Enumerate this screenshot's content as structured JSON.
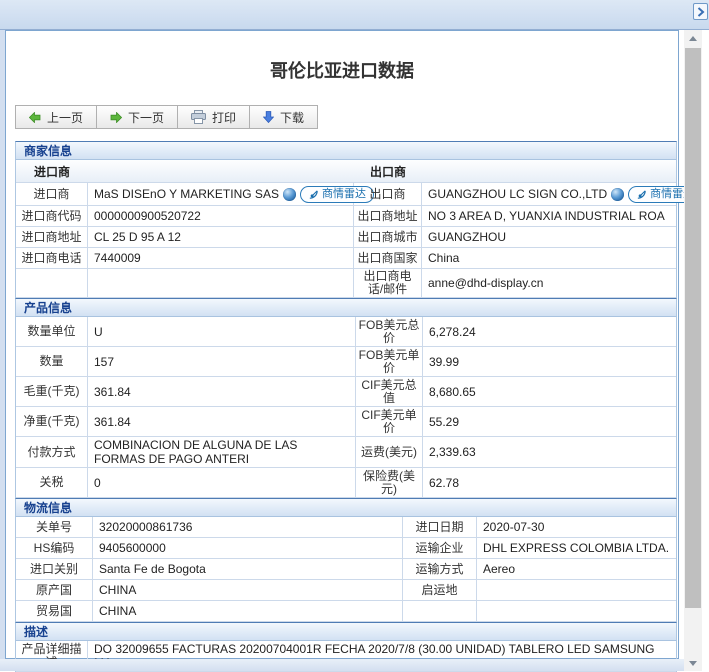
{
  "page": {
    "title": "哥伦比亚进口数据"
  },
  "toolbar": {
    "prev_label": "上一页",
    "next_label": "下一页",
    "print_label": "打印",
    "download_label": "下载"
  },
  "radar_badge_label": "商情雷达",
  "colors": {
    "section_header_text": "#17418f",
    "badge_blue": "#1a6fae",
    "green_arrow": "#5cb63c",
    "download_blue": "#4a7fe0",
    "frame_blue": "#d3dff0"
  },
  "sections": {
    "merchant": {
      "title": "商家信息",
      "subheader": {
        "left": "进口商",
        "right": "出口商"
      },
      "rows": [
        {
          "l1": "进口商",
          "v1": "MaS DISEnO Y MARKETING SAS",
          "l2": "出口商",
          "v2": "GUANGZHOU LC SIGN CO.,LTD"
        },
        {
          "l1": "进口商代码",
          "v1": "0000000900520722",
          "l2": "出口商地址",
          "v2": "NO 3 AREA D, YUANXIA INDUSTRIAL ROA"
        },
        {
          "l1": "进口商地址",
          "v1": "CL 25 D 95 A 12",
          "l2": "出口商城市",
          "v2": "GUANGZHOU"
        },
        {
          "l1": "进口商电话",
          "v1": "7440009",
          "l2": "出口商国家",
          "v2": "China"
        },
        {
          "l1": "",
          "v1": "",
          "l2": "出口商电话/邮件",
          "v2": "anne@dhd-display.cn"
        }
      ]
    },
    "product": {
      "title": "产品信息",
      "rows": [
        {
          "l1": "数量单位",
          "v1": "U",
          "l2": "FOB美元总价",
          "v2": "6,278.24"
        },
        {
          "l1": "数量",
          "v1": "157",
          "l2": "FOB美元单价",
          "v2": "39.99"
        },
        {
          "l1": "毛重(千克)",
          "v1": "361.84",
          "l2": "CIF美元总值",
          "v2": "8,680.65"
        },
        {
          "l1": "净重(千克)",
          "v1": "361.84",
          "l2": "CIF美元单价",
          "v2": "55.29"
        },
        {
          "l1": "付款方式",
          "v1": "COMBINACION DE ALGUNA DE LAS FORMAS DE PAGO ANTERI",
          "l2": "运费(美元)",
          "v2": "2,339.63"
        },
        {
          "l1": "关税",
          "v1": "0",
          "l2": "保险费(美元)",
          "v2": "62.78"
        }
      ]
    },
    "logistics": {
      "title": "物流信息",
      "rows": [
        {
          "l1": "关单号",
          "v1": "32020000861736",
          "l2": "进口日期",
          "v2": "2020-07-30"
        },
        {
          "l1": "HS编码",
          "v1": "9405600000",
          "l2": "运输企业",
          "v2": "DHL EXPRESS COLOMBIA LTDA."
        },
        {
          "l1": "进口关别",
          "v1": "Santa Fe de Bogota",
          "l2": "运输方式",
          "v2": "Aereo"
        },
        {
          "l1": "原产国",
          "v1": "CHINA",
          "l2": "启运地",
          "v2": ""
        },
        {
          "l1": "贸易国",
          "v1": "CHINA",
          "l2": "",
          "v2": ""
        }
      ]
    },
    "description": {
      "title": "描述",
      "label": "产品详细描述",
      "value": "DO 32009655 FACTURAS 20200704001R FECHA 2020/7/8 (30.00 UNIDAD) TABLERO LED SAMSUNG MA"
    }
  }
}
